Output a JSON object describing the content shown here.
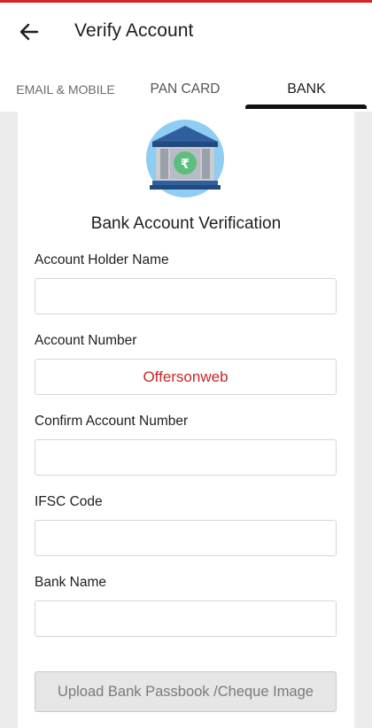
{
  "app_bar": {
    "title": "Verify Account",
    "back_icon": "arrow-left-icon"
  },
  "tabs": [
    {
      "label": "EMAIL & MOBILE",
      "active": false
    },
    {
      "label": "PAN CARD",
      "active": false
    },
    {
      "label": "BANK",
      "active": true
    }
  ],
  "card": {
    "icon": "bank-building-rupee-icon",
    "heading": "Bank Account Verification",
    "fields": [
      {
        "label": "Account Holder Name",
        "value": ""
      },
      {
        "label": "Account Number",
        "value": "Offersonweb"
      },
      {
        "label": "Confirm Account Number",
        "value": ""
      },
      {
        "label": "IFSC Code",
        "value": ""
      },
      {
        "label": "Bank Name",
        "value": ""
      }
    ],
    "upload_button": "Upload Bank Passbook /Cheque Image"
  },
  "colors": {
    "accent": "#d8232a",
    "tab_indicator": "#111111",
    "icon_circle": "#8fcdf3",
    "bank_dark": "#2f5f9e",
    "rupee_green": "#5cbf7e",
    "watermark_text": "#c62828"
  }
}
